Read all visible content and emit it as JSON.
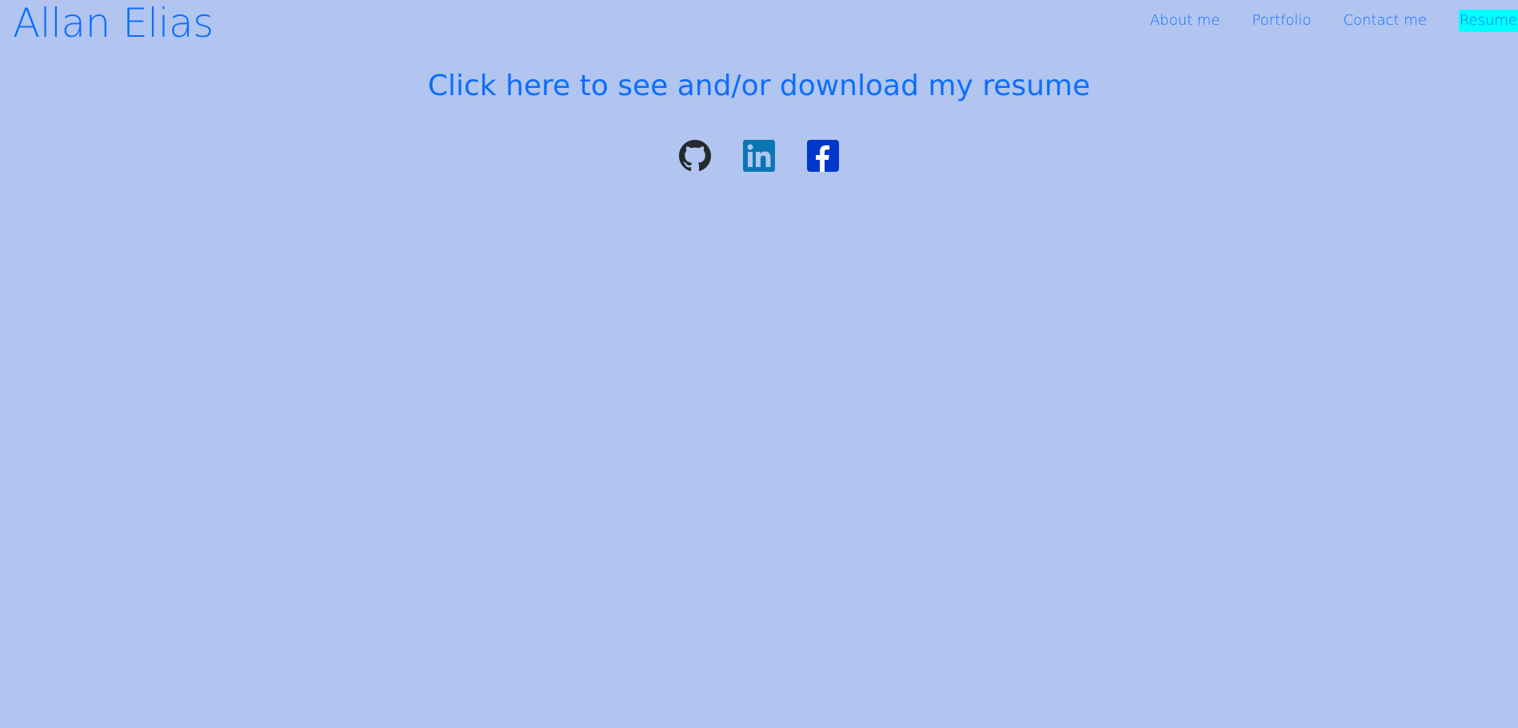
{
  "header": {
    "title": "Allan Elias"
  },
  "nav": {
    "items": [
      {
        "label": "About me"
      },
      {
        "label": "Portfolio"
      },
      {
        "label": "Contact me"
      },
      {
        "label": "Resume"
      }
    ]
  },
  "main": {
    "resume_link_text": "Click here to see and/or download my resume"
  },
  "socials": {
    "icons": [
      "github-icon",
      "linkedin-icon",
      "facebook-icon"
    ]
  },
  "colors": {
    "background": "#b1c5f0",
    "link": "#0d6efd",
    "active_highlight": "#00ffff",
    "github": "#24292e",
    "linkedin": "#0a77b5",
    "facebook": "#0037c9"
  }
}
